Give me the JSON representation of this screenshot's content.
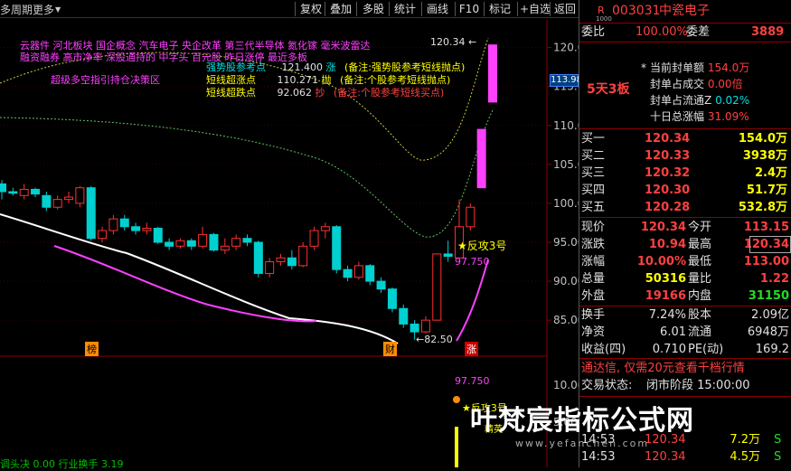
{
  "toolbar": {
    "left_label": "多周期",
    "more_label": "更多",
    "buttons": [
      "复权",
      "叠加",
      "多股",
      "统计",
      "画线",
      "F10",
      "标记",
      "+自选",
      "返回"
    ]
  },
  "indicator_text": {
    "line1": "云器件 河北板块 国企概念 汽车电子 央企改革 第三代半导体 氮化镓 毫米波雷达",
    "line2": "融资融券 高市净率 深股通持的 中字头 百元股 昨日涨停 最近多板",
    "right_label": "超级多空指引持仓决策区",
    "rows": [
      {
        "label": "强势股参考点",
        "value": "121.400",
        "tag": "涨",
        "note": "(备注:强势股参考短线抛点)"
      },
      {
        "label": "短线超涨点",
        "value": "110.271",
        "tag": "抛",
        "note": "(备注:个股参考短线抛点)"
      },
      {
        "label": "短线超跌点",
        "value": "92.062",
        "tag": "抄",
        "note": "(备注:个股参考短线买点)"
      }
    ]
  },
  "chart_annotations": {
    "high_label": "120.34",
    "low_label": "82.50",
    "fangong": "★反攻3号",
    "fangong_value": "97.750",
    "sub_value": "97.750",
    "sub_fangong": "★反攻3号",
    "sub_small": "精英",
    "marker_bang": "榜",
    "marker_cai": "财",
    "marker_zhang": "涨",
    "current_price_tag": "113.98",
    "bottom_text": "调头决 0.00 行业换手 3.19"
  },
  "chart_data": {
    "type": "candlestick",
    "y_ticks": [
      "120.0",
      "115.0",
      "110.0",
      "105.0",
      "100.0",
      "95.00",
      "90.00",
      "85.00",
      "10.00",
      "5.00"
    ],
    "candles": [
      {
        "o": 102.5,
        "c": 101.5,
        "h": 103,
        "l": 100.5
      },
      {
        "o": 101.5,
        "c": 101.3,
        "h": 102,
        "l": 101
      },
      {
        "o": 101.0,
        "c": 101.8,
        "h": 102.5,
        "l": 100.5
      },
      {
        "o": 101.8,
        "c": 101.2,
        "h": 102,
        "l": 100.8
      },
      {
        "o": 101.0,
        "c": 99.5,
        "h": 101.5,
        "l": 99.0
      },
      {
        "o": 99.5,
        "c": 100.5,
        "h": 101,
        "l": 99.2
      },
      {
        "o": 100.5,
        "c": 100.8,
        "h": 101.5,
        "l": 100
      },
      {
        "o": 100.0,
        "c": 102.0,
        "h": 102.2,
        "l": 99.5
      },
      {
        "o": 102.0,
        "c": 95.5,
        "h": 102.2,
        "l": 95.2
      },
      {
        "o": 95.5,
        "c": 96.5,
        "h": 97,
        "l": 95
      },
      {
        "o": 96.5,
        "c": 98.0,
        "h": 98.5,
        "l": 96
      },
      {
        "o": 98.0,
        "c": 97.0,
        "h": 98.5,
        "l": 96.5
      },
      {
        "o": 97.0,
        "c": 96.5,
        "h": 97.5,
        "l": 96
      },
      {
        "o": 96.5,
        "c": 96.8,
        "h": 97.5,
        "l": 96
      },
      {
        "o": 96.8,
        "c": 95.0,
        "h": 97,
        "l": 94.8
      },
      {
        "o": 95.0,
        "c": 94.5,
        "h": 95.5,
        "l": 94
      },
      {
        "o": 94.5,
        "c": 95.2,
        "h": 95.5,
        "l": 94.2
      },
      {
        "o": 95.2,
        "c": 94.5,
        "h": 95.5,
        "l": 94
      },
      {
        "o": 94.5,
        "c": 96.0,
        "h": 97,
        "l": 94.2
      },
      {
        "o": 96.0,
        "c": 94.0,
        "h": 96.2,
        "l": 93.8
      },
      {
        "o": 94.0,
        "c": 94.5,
        "h": 95.5,
        "l": 93.5
      },
      {
        "o": 94.5,
        "c": 95.5,
        "h": 96,
        "l": 94
      },
      {
        "o": 95.5,
        "c": 95.0,
        "h": 96,
        "l": 94.5
      },
      {
        "o": 95.0,
        "c": 91.0,
        "h": 95.2,
        "l": 90.5
      },
      {
        "o": 91.0,
        "c": 92.5,
        "h": 93,
        "l": 90.5
      },
      {
        "o": 92.5,
        "c": 93.0,
        "h": 93.5,
        "l": 92
      },
      {
        "o": 93.0,
        "c": 92.0,
        "h": 94,
        "l": 91.5
      },
      {
        "o": 92.0,
        "c": 94.5,
        "h": 95,
        "l": 91.8
      },
      {
        "o": 94.5,
        "c": 96.5,
        "h": 97,
        "l": 94
      },
      {
        "o": 96.5,
        "c": 97.0,
        "h": 97.5,
        "l": 95.5
      },
      {
        "o": 97.0,
        "c": 91.5,
        "h": 97.2,
        "l": 91
      },
      {
        "o": 91.5,
        "c": 90.5,
        "h": 92,
        "l": 90
      },
      {
        "o": 90.5,
        "c": 92.0,
        "h": 92.5,
        "l": 90.2
      },
      {
        "o": 92.0,
        "c": 90.0,
        "h": 92.2,
        "l": 89.5
      },
      {
        "o": 90.0,
        "c": 89.0,
        "h": 90.5,
        "l": 88.5
      },
      {
        "o": 89.0,
        "c": 86.5,
        "h": 89.2,
        "l": 86
      },
      {
        "o": 86.5,
        "c": 84.5,
        "h": 87,
        "l": 84
      },
      {
        "o": 84.5,
        "c": 83.5,
        "h": 85,
        "l": 82.5
      },
      {
        "o": 83.5,
        "c": 85.0,
        "h": 85.5,
        "l": 83.3
      },
      {
        "o": 85.0,
        "c": 93.5,
        "h": 93.5,
        "l": 85
      },
      {
        "o": 93.5,
        "c": 93.2,
        "h": 95.2,
        "l": 92.5
      },
      {
        "o": 93.0,
        "c": 97.0,
        "h": 100.5,
        "l": 93
      },
      {
        "o": 97.0,
        "c": 99.5,
        "h": 100,
        "l": 96.5
      },
      {
        "o": 102.0,
        "c": 109.5,
        "h": 109.5,
        "l": 102
      },
      {
        "o": 113.0,
        "c": 120.34,
        "h": 120.34,
        "l": 113
      }
    ]
  },
  "stock": {
    "code_prefix": "R",
    "code_sub": "1000",
    "code": "003031",
    "name": "中瓷电子",
    "weibi_label": "委比",
    "weibi_value": "100.00%",
    "weicha_label": "委差",
    "weicha_value": "3889",
    "streak": "5天3板",
    "stats": [
      {
        "label": "当前封单额",
        "value": "154.0万"
      },
      {
        "label": "封单占成交",
        "value": "0.00倍"
      },
      {
        "label": "封单占流通Z",
        "value": "0.02%"
      },
      {
        "label": "十日总涨幅",
        "value": "31.09%"
      }
    ],
    "bids": [
      {
        "label": "买一",
        "price": "120.34",
        "vol": "154.0万"
      },
      {
        "label": "买二",
        "price": "120.33",
        "vol": "3938万"
      },
      {
        "label": "买三",
        "price": "120.32",
        "vol": "2.4万"
      },
      {
        "label": "买四",
        "price": "120.30",
        "vol": "51.7万"
      },
      {
        "label": "买五",
        "price": "120.28",
        "vol": "532.8万"
      }
    ],
    "quote": [
      {
        "l1": "现价",
        "v1": "120.34",
        "c1": "red",
        "l2": "今开",
        "v2": "113.15",
        "c2": "red"
      },
      {
        "l1": "涨跌",
        "v1": "10.94",
        "c1": "red",
        "l2": "最高",
        "v2": "120.34",
        "c2": "red"
      },
      {
        "l1": "涨幅",
        "v1": "10.00%",
        "c1": "red",
        "l2": "最低",
        "v2": "113.00",
        "c2": "red"
      },
      {
        "l1": "总量",
        "v1": "50316",
        "c1": "yellow",
        "l2": "量比",
        "v2": "1.22",
        "c2": "red"
      },
      {
        "l1": "外盘",
        "v1": "19166",
        "c1": "red",
        "l2": "内盘",
        "v2": "31150",
        "c2": "green"
      }
    ],
    "fund": [
      {
        "l1": "换手",
        "v1": "7.24%",
        "l2": "股本",
        "v2": "2.09亿"
      },
      {
        "l1": "净资",
        "v1": "6.01",
        "l2": "流通",
        "v2": "6948万"
      },
      {
        "l1": "收益(四)",
        "v1": "0.710",
        "l2": "PE(动)",
        "v2": "169.2"
      }
    ],
    "ad_text": "通达信, 仅需20元查看千档行情",
    "status_label": "交易状态:",
    "status_value": "闭市阶段 15:00:00",
    "ticks": [
      {
        "time": "14:53",
        "price": "120.34",
        "vol": "7.2万",
        "side": "S"
      },
      {
        "time": "14:53",
        "price": "120.34",
        "vol": "4.5万",
        "side": "S"
      }
    ]
  },
  "watermark": {
    "text": "叶梵宸指标公式网",
    "url": "www.yefanchen.com"
  }
}
